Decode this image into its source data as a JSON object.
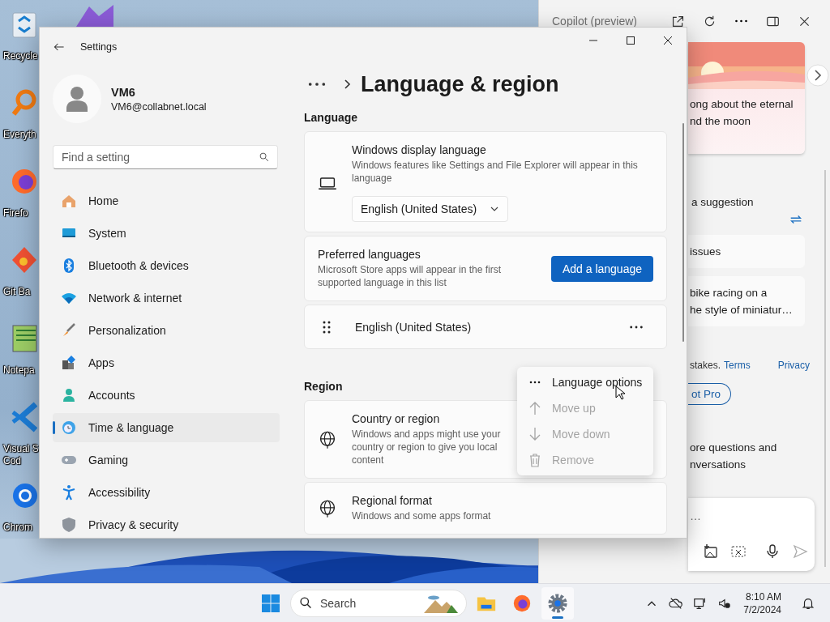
{
  "desktop": {
    "icons": [
      {
        "lines": [
          "Recycle"
        ]
      },
      {
        "lines": [
          "Everyth"
        ]
      },
      {
        "lines": [
          "Firefo"
        ]
      },
      {
        "lines": [
          "Git Ba"
        ]
      },
      {
        "lines": [
          "Notepa"
        ]
      },
      {
        "lines": [
          "Visual S",
          "Cod"
        ]
      },
      {
        "lines": [
          "Chrom"
        ]
      }
    ]
  },
  "settings": {
    "title": "Settings",
    "user": {
      "name": "VM6",
      "email": "VM6@collabnet.local"
    },
    "search": {
      "placeholder": "Find a setting"
    },
    "nav": [
      {
        "label": "Home",
        "selected": false
      },
      {
        "label": "System",
        "selected": false
      },
      {
        "label": "Bluetooth & devices",
        "selected": false
      },
      {
        "label": "Network & internet",
        "selected": false
      },
      {
        "label": "Personalization",
        "selected": false
      },
      {
        "label": "Apps",
        "selected": false
      },
      {
        "label": "Accounts",
        "selected": false
      },
      {
        "label": "Time & language",
        "selected": true
      },
      {
        "label": "Gaming",
        "selected": false
      },
      {
        "label": "Accessibility",
        "selected": false
      },
      {
        "label": "Privacy & security",
        "selected": false
      }
    ],
    "page_title": "Language & region",
    "language": {
      "heading": "Language",
      "display": {
        "title": "Windows display language",
        "description": "Windows features like Settings and File Explorer will appear in this language",
        "value": "English (United States)"
      },
      "preferred": {
        "title": "Preferred languages",
        "description": "Microsoft Store apps will appear in the first supported language in this list",
        "button": "Add a language"
      },
      "languages": [
        {
          "name": "English (United States)"
        }
      ]
    },
    "region": {
      "heading": "Region",
      "items": [
        {
          "title": "Country or region",
          "description": "Windows and apps might use your country or region to give you local content"
        },
        {
          "title": "Regional format",
          "description": "Windows and some apps format"
        }
      ]
    },
    "menu": [
      {
        "label": "Language options",
        "disabled": false
      },
      {
        "label": "Move up",
        "disabled": true
      },
      {
        "label": "Move down",
        "disabled": true
      },
      {
        "label": "Remove",
        "disabled": true
      }
    ]
  },
  "copilot": {
    "title": "Copilot (preview)",
    "card_lines": [
      "ong about the eternal",
      "nd the moon"
    ],
    "suggestion": "a suggestion",
    "prompts": [
      {
        "lines": [
          "issues"
        ]
      },
      {
        "lines": [
          "bike racing on a",
          "he style of miniatur…"
        ]
      }
    ],
    "notice": "stakes.",
    "terms": "Terms",
    "privacy": "Privacy",
    "pro_button": "ot Pro",
    "info_lines": [
      "ore questions and",
      "nversations"
    ],
    "input": {
      "placeholder": "…"
    }
  },
  "taskbar": {
    "search": {
      "placeholder": "Search"
    },
    "apps": [
      {
        "active": false
      },
      {
        "active": false
      },
      {
        "active": true
      }
    ],
    "time": "8:10 AM",
    "date": "7/2/2024"
  }
}
